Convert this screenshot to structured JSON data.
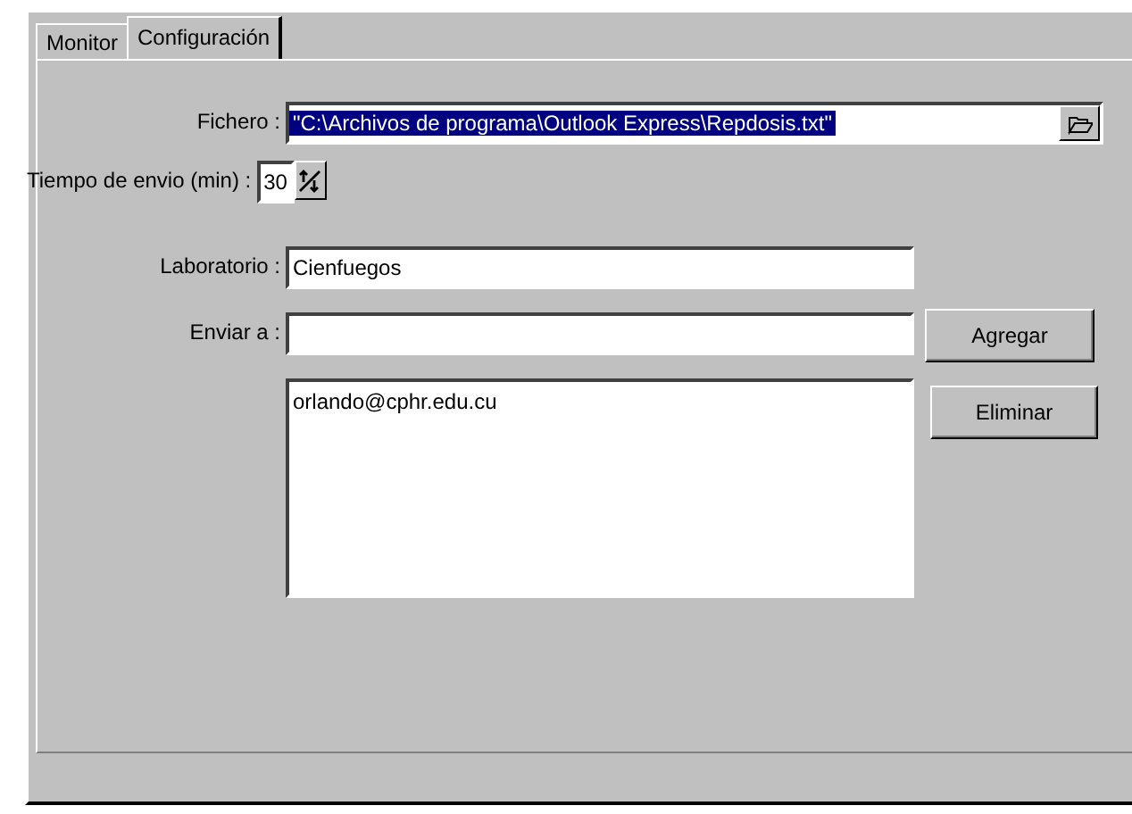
{
  "tabs": [
    {
      "label": "Monitor",
      "selected": false
    },
    {
      "label": "Configuración",
      "selected": true
    }
  ],
  "form": {
    "file": {
      "label": "Fichero :",
      "value": "\"C:\\Archivos de programa\\Outlook Express\\Repdosis.txt\"",
      "selected": true
    },
    "interval": {
      "label": "Tiempo de envio (min) :",
      "value": "30"
    },
    "lab": {
      "label": "Laboratorio :",
      "value": "Cienfuegos"
    },
    "send_to": {
      "label": "Enviar a :"
    },
    "recipients": [
      "orlando@cphr.edu.cu"
    ],
    "buttons": [
      "Agregar",
      "Eliminar"
    ]
  }
}
